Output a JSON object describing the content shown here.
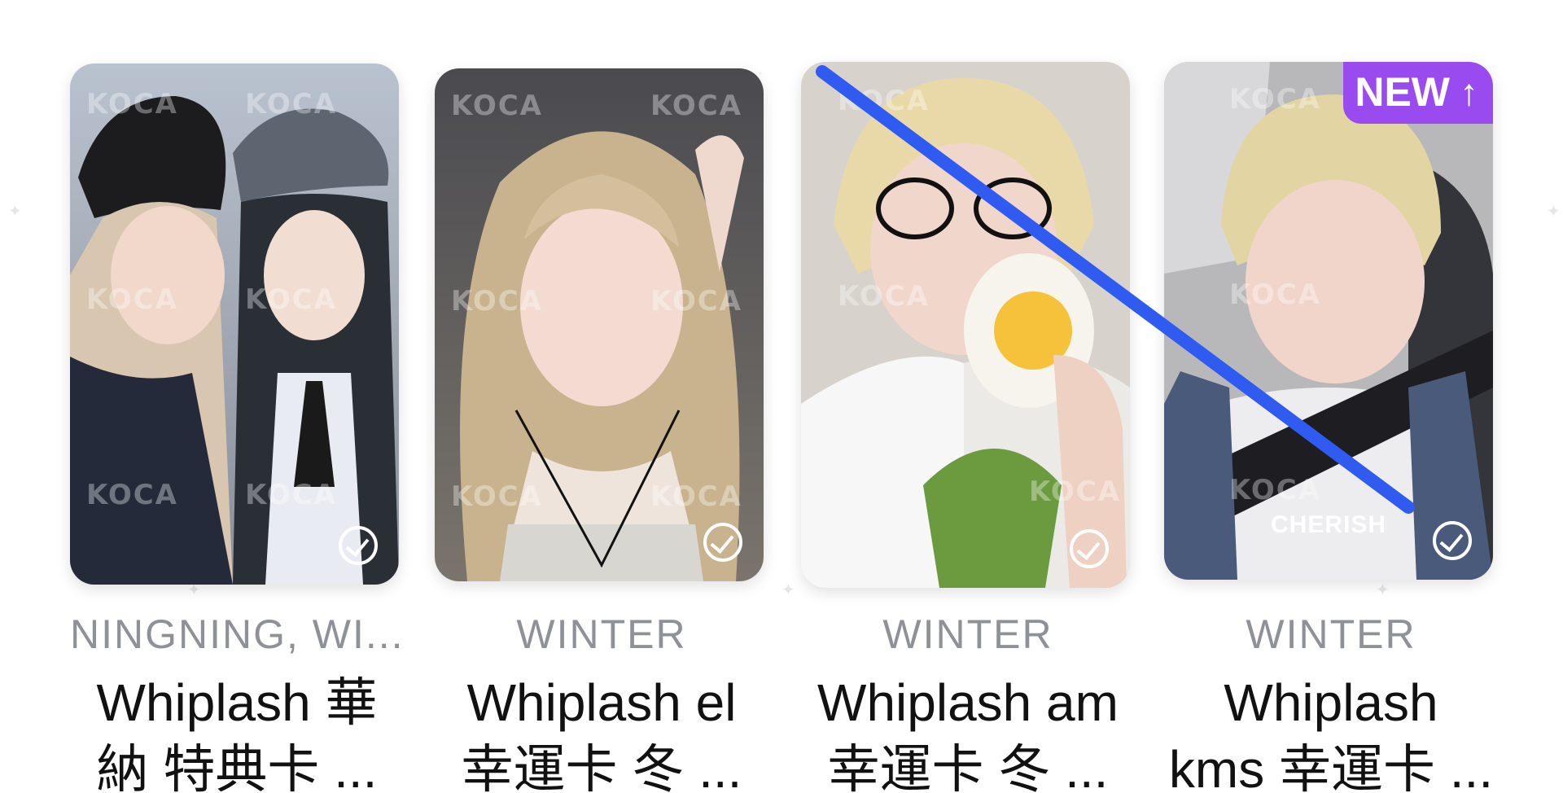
{
  "watermark": "KOCA",
  "cards": [
    {
      "member": "NINGNING, WI...",
      "title": "Whiplash 華\n納 特典卡 ...",
      "selected": true
    },
    {
      "member": "WINTER",
      "title": "Whiplash el\n幸運卡 冬 ...",
      "selected": true
    },
    {
      "member": "WINTER",
      "title": "Whiplash am\n幸運卡 冬 ...",
      "selected": true,
      "crossed_out": true
    },
    {
      "member": "WINTER",
      "title": "Whiplash\nkms 幸運卡 ...",
      "selected": true,
      "badge": "NEW",
      "overlay_label": "CHERISH"
    }
  ],
  "colors": {
    "badge": "#9a4bf0",
    "strike": "#2f5bf0",
    "member_text": "#8e9197",
    "title_text": "#111111"
  },
  "icons": [
    "checkmark-circle-icon",
    "arrow-up-icon"
  ]
}
